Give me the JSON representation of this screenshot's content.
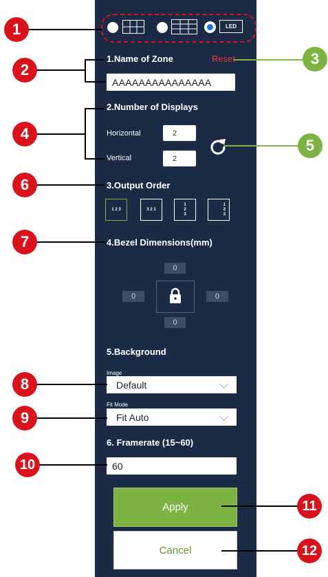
{
  "mode_options": [
    {
      "name": "grid",
      "selected": false
    },
    {
      "name": "multi-grid",
      "selected": false
    },
    {
      "name": "LED",
      "selected": true,
      "label": "LED"
    }
  ],
  "zone": {
    "title": "1.Name of Zone",
    "reset_label": "Reset",
    "name_value": "AAAAAAAAAAAAAAA"
  },
  "displays": {
    "title": "2.Number of Displays",
    "horizontal_label": "Horizontal",
    "horizontal_value": "2",
    "vertical_label": "Vertical",
    "vertical_value": "2"
  },
  "output_order": {
    "title": "3.Output Order",
    "options": [
      "1 2 3",
      "3 2 1",
      "1\n2\n3",
      "1\n2\n3"
    ]
  },
  "bezel": {
    "title": "4.Bezel Dimensions(mm)",
    "top": "0",
    "left": "0",
    "right": "0",
    "bottom": "0"
  },
  "background": {
    "title": "5.Background",
    "image_label": "Image",
    "image_value": "Default",
    "fit_label": "Fit Mode",
    "fit_value": "Fit Auto"
  },
  "framerate": {
    "title": "6. Framerate (15~60)",
    "value": "60"
  },
  "buttons": {
    "apply": "Apply",
    "cancel": "Cancel"
  },
  "callouts": [
    "1",
    "2",
    "3",
    "4",
    "5",
    "6",
    "7",
    "8",
    "9",
    "10",
    "11",
    "12"
  ],
  "colors": {
    "panel": "#1b2b45",
    "accent_green": "#7cb342",
    "reset_red": "#e53935",
    "callout_red": "#d9121c"
  }
}
